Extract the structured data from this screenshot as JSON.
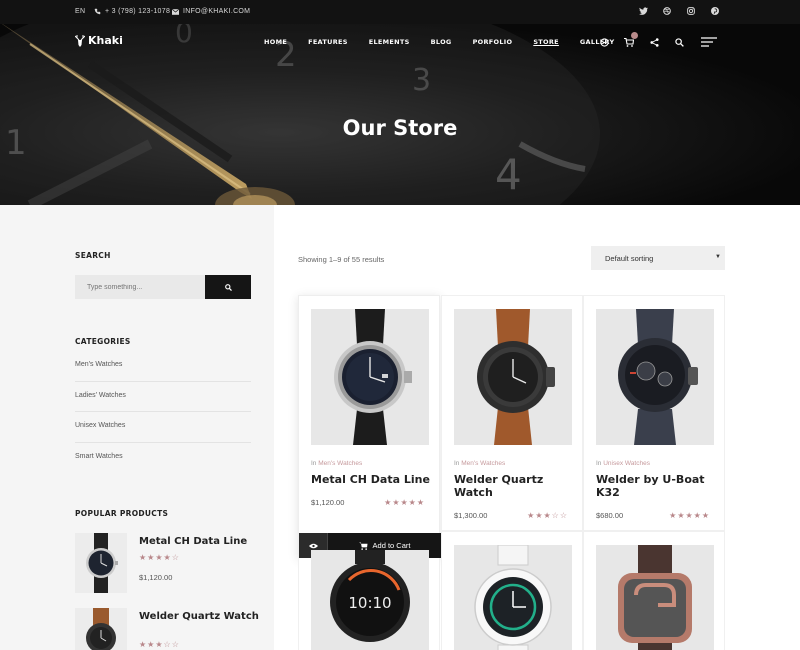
{
  "topbar": {
    "language": "EN",
    "phone": "+ 3 (798) 123-1078",
    "email": "INFO@KHAKI.COM",
    "socials": [
      "twitter-icon",
      "dribbble-icon",
      "instagram-icon",
      "pinterest-icon"
    ]
  },
  "brand": {
    "name": "Khaki"
  },
  "nav": {
    "items": [
      "HOME",
      "FEATURES",
      "ELEMENTS",
      "BLOG",
      "PORFOLIO",
      "STORE",
      "GALLERY"
    ],
    "active": "STORE",
    "icons": [
      "login-icon",
      "cart-icon",
      "share-icon",
      "search-icon",
      "hamburger-menu-icon"
    ]
  },
  "page": {
    "title": "Our Store"
  },
  "sidebar": {
    "search_heading": "SEARCH",
    "search_placeholder": "Type something...",
    "categories_heading": "CATEGORIES",
    "categories": [
      "Men's Watches",
      "Ladies' Watches",
      "Unisex Watches",
      "Smart Watches"
    ],
    "popular_heading": "POPULAR PRODUCTS",
    "popular": [
      {
        "name": "Metal CH Data Line",
        "rating": 4.5,
        "stars": "★★★★☆",
        "price": "$1,120.00"
      },
      {
        "name": "Welder Quartz Watch",
        "rating": 2.5,
        "stars": "★★★☆☆",
        "price": ""
      }
    ]
  },
  "shop": {
    "results_text": "Showing 1–9 of 55 results",
    "sorting": "Default sorting",
    "category_prefix": "In",
    "add_to_cart": "Add to Cart",
    "products": [
      {
        "category": "Men's Watches",
        "title": "Metal CH Data Line",
        "price": "$1,120.00",
        "rating": 4.5,
        "stars": "★★★★★"
      },
      {
        "category": "Men's Watches",
        "title": "Welder Quartz Watch",
        "price": "$1,300.00",
        "rating": 2.5,
        "stars": "★★★☆☆"
      },
      {
        "category": "Unisex Watches",
        "title": "Welder by U-Boat K32",
        "price": "$680.00",
        "rating": 5,
        "stars": "★★★★★"
      }
    ]
  },
  "colors": {
    "accent": "#c69a9d",
    "dark": "#151515",
    "sidebar_bg": "#f5f5f5"
  }
}
